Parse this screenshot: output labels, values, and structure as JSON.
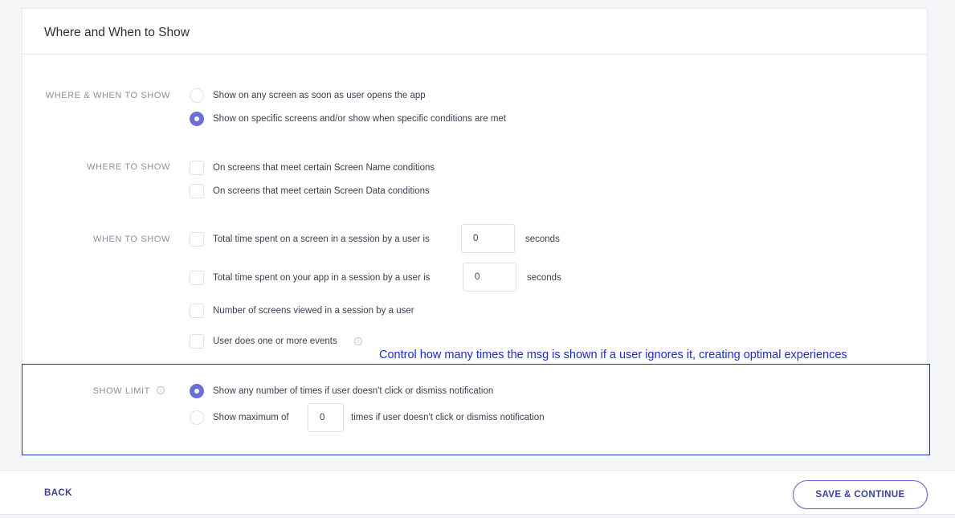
{
  "card": {
    "title": "Where and When to Show"
  },
  "where_when": {
    "label": "WHERE & WHEN TO SHOW",
    "options": [
      {
        "label": "Show on any screen as soon as user opens the app",
        "selected": false
      },
      {
        "label": "Show on specific screens and/or show when specific conditions are met",
        "selected": true
      }
    ]
  },
  "where": {
    "label": "WHERE TO SHOW",
    "options": [
      {
        "label": "On screens that meet certain Screen Name conditions",
        "checked": false
      },
      {
        "label": "On screens that meet certain Screen Data conditions",
        "checked": false
      }
    ]
  },
  "when": {
    "label": "WHEN TO SHOW",
    "screen_time": {
      "label": "Total time spent on a screen in a session by a user is",
      "value": "0",
      "unit": "seconds",
      "checked": false
    },
    "app_time": {
      "label": "Total time spent on your app in a session by a user is",
      "value": "0",
      "unit": "seconds",
      "checked": false
    },
    "screens_viewed": {
      "label": "Number of screens viewed in a session by a user",
      "checked": false
    },
    "events": {
      "label": "User does one or more events",
      "checked": false
    }
  },
  "show_limit": {
    "label": "SHOW LIMIT",
    "any_label": "Show any number of times if user doesn't click or dismiss notification",
    "max_prefix": "Show maximum of",
    "max_value": "0",
    "max_suffix": "times if user doesn't click or dismiss notification",
    "selected": "any"
  },
  "annotation": "Control how many times the msg is shown if a user ignores it, creating optimal experiences",
  "footer": {
    "back_label": "BACK",
    "save_label": "SAVE & CONTINUE"
  },
  "colors": {
    "accent": "#6a6fd9",
    "annotation": "#1a2bd9",
    "button_text": "#3b3f9e"
  }
}
